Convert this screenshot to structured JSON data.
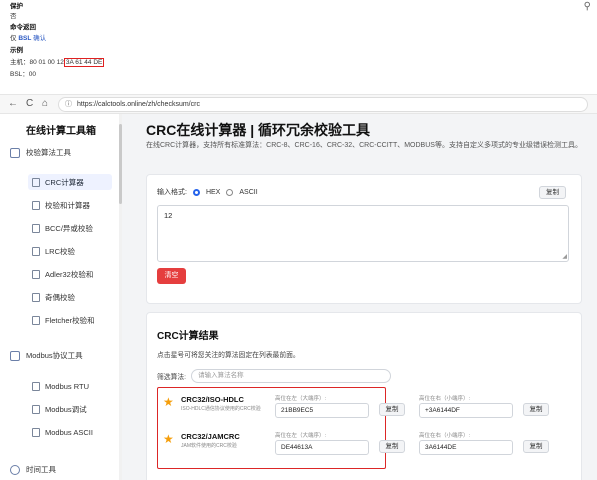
{
  "doc": {
    "protect_label": "保护",
    "protect_value": "否",
    "cmd_return_label": "命令返回",
    "cmd_return_prefix": "仅",
    "cmd_return_bsl": "BSL",
    "cmd_return_suffix": "确认",
    "example_label": "示例",
    "host_prefix": "主机：80 01 00 12",
    "host_highlight": "3A 61 44 DE",
    "bsl_line": "BSL：00"
  },
  "browser": {
    "back_icon": "←",
    "refresh_icon": "C",
    "home_icon": "⌂",
    "url": "https://calctools.online/zh/checksum/crc"
  },
  "sidebar": {
    "title": "在线计算工具箱",
    "group1": "校验算法工具",
    "items": [
      "CRC计算器",
      "校验和计算器",
      "BCC/异或校验",
      "LRC校验",
      "Adler32校验和",
      "奇偶校验",
      "Fletcher校验和"
    ],
    "group2": "Modbus协议工具",
    "items2": [
      "Modbus RTU",
      "Modbus调试",
      "Modbus ASCII"
    ],
    "group3": "时间工具"
  },
  "main": {
    "title": "CRC在线计算器 | 循环冗余校验工具",
    "desc": "在线CRC计算器，支持所有标准算法：CRC-8、CRC-16、CRC-32、CRC-CCITT、MODBUS等。支持自定义多项式的专业级错误检测工具。"
  },
  "input": {
    "format_label": "输入格式:",
    "hex": "HEX",
    "ascii": "ASCII",
    "copy": "复制",
    "value": "12",
    "clear": "清空"
  },
  "results": {
    "title": "CRC计算结果",
    "tip": "点击星号可将您关注的算法固定在列表最前面。",
    "filter_label": "筛选算法:",
    "filter_placeholder": "请输入算法名称",
    "big_label": "高位在左（大端序）:",
    "little_label": "高位在右（小端序）:",
    "copy": "复制",
    "rows": [
      {
        "name": "CRC32/ISO-HDLC",
        "sub": "ISO-HDLC通信协议使用的CRC校验",
        "big": "21BB9EC5",
        "little": "+3A6144DF"
      },
      {
        "name": "CRC32/JAMCRC",
        "sub": "JAM软件使用的CRC校验",
        "big": "DE44613A",
        "little": "3A6144DE"
      }
    ]
  }
}
